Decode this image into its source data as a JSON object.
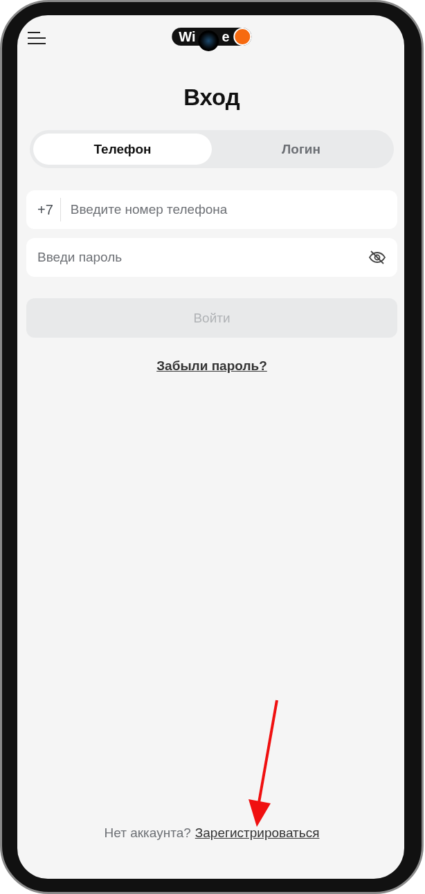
{
  "header": {
    "logo_start": "Wi",
    "logo_end": "e"
  },
  "title": "Вход",
  "tabs": [
    {
      "label": "Телефон",
      "selected": true
    },
    {
      "label": "Логин",
      "selected": false
    }
  ],
  "phone_field": {
    "prefix": "+7",
    "placeholder": "Введите номер телефона"
  },
  "password_field": {
    "placeholder": "Введи пароль",
    "visible": false
  },
  "submit": {
    "label": "Войти",
    "disabled": true
  },
  "forgot_link": "Забыли пароль?",
  "footer": {
    "text": "Нет аккаунта?",
    "link": "Зарегистрироваться"
  }
}
